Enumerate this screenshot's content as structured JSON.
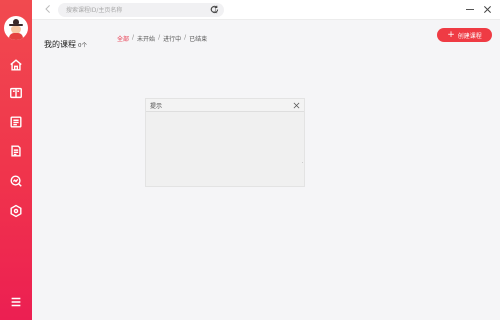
{
  "topbar": {
    "search_placeholder": "搜索课程ID/主页名称"
  },
  "main": {
    "title": "我的课程",
    "count": "0个",
    "filters": [
      "全部",
      "未开始",
      "进行中",
      "已结束"
    ],
    "active_filter_index": 0,
    "create_button_label": "创建课程"
  },
  "dialog": {
    "title": "提示"
  },
  "colors": {
    "accent": "#ef3b44",
    "sidebar_top": "#f14a4f",
    "sidebar_bottom": "#ec1f52"
  }
}
